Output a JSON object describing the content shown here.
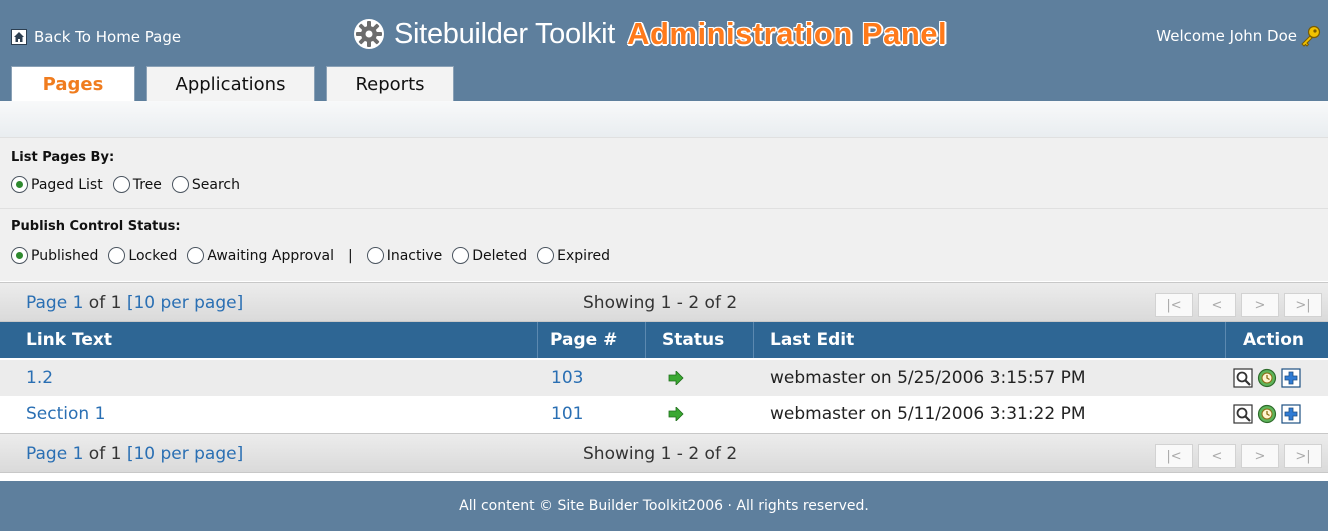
{
  "header": {
    "home_label": "Back To Home Page",
    "brand_name": "Sitebuilder Toolkit",
    "brand_panel": "Administration Panel",
    "welcome": "Welcome John Doe"
  },
  "tabs": [
    {
      "label": "Pages",
      "active": true
    },
    {
      "label": "Applications",
      "active": false
    },
    {
      "label": "Reports",
      "active": false
    }
  ],
  "list_by": {
    "title": "List Pages By:",
    "options": [
      "Paged List",
      "Tree",
      "Search"
    ],
    "selected": "Paged List"
  },
  "publish_status": {
    "title": "Publish Control Status:",
    "options": [
      "Published",
      "Locked",
      "Awaiting Approval",
      "Inactive",
      "Deleted",
      "Expired"
    ],
    "separator": "|",
    "selected": "Published"
  },
  "pager": {
    "page_word": "Page",
    "page_current": "1",
    "page_of": "of 1",
    "per_page": "[10 per page]",
    "showing": "Showing 1 - 2 of 2",
    "nav": [
      "|<",
      "<",
      ">",
      ">|"
    ]
  },
  "table": {
    "columns": [
      "Link Text",
      "Page #",
      "Status",
      "Last Edit",
      "Action"
    ],
    "rows": [
      {
        "link_text": "1.2",
        "page": "103",
        "status_icon": "arrow-right-icon",
        "last_edit": "webmaster on 5/25/2006 3:15:57 PM"
      },
      {
        "link_text": "Section 1",
        "page": "101",
        "status_icon": "arrow-right-icon",
        "last_edit": "webmaster on 5/11/2006 3:31:22 PM"
      }
    ],
    "action_icons": [
      "preview-icon",
      "history-icon",
      "add-icon"
    ]
  },
  "footer": {
    "text": "All content © Site Builder Toolkit2006 · All rights reserved."
  },
  "colors": {
    "header_bg": "#5e7f9d",
    "table_header_bg": "#2e6694",
    "accent_orange": "#f07c1e",
    "link_blue": "#2a6fb3",
    "status_green": "#3aa832"
  }
}
